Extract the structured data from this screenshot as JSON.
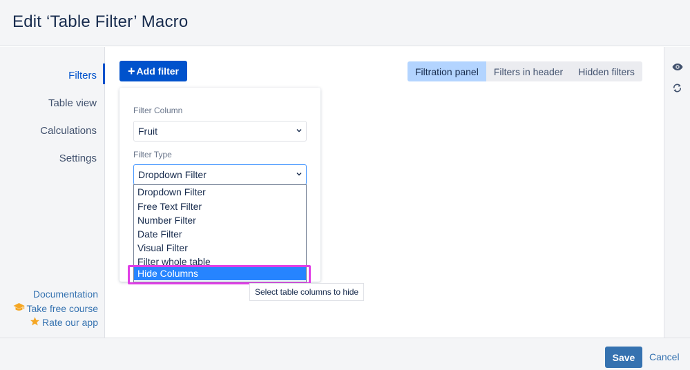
{
  "dialog": {
    "title": "Edit ‘Table Filter’ Macro"
  },
  "sidebar": {
    "items": [
      {
        "label": "Filters",
        "active": true
      },
      {
        "label": "Table view",
        "active": false
      },
      {
        "label": "Calculations",
        "active": false
      },
      {
        "label": "Settings",
        "active": false
      }
    ],
    "links": [
      {
        "label": "Documentation",
        "icon": ""
      },
      {
        "label": "Take free course",
        "icon": "graduation-cap-icon"
      },
      {
        "label": "Rate our app",
        "icon": "star-icon"
      }
    ]
  },
  "toolbar": {
    "add_filter_label": "Add filter",
    "add_icon": "plus-icon"
  },
  "tabs": [
    {
      "label": "Filtration panel",
      "active": true
    },
    {
      "label": "Filters in header",
      "active": false
    },
    {
      "label": "Hidden filters",
      "active": false
    }
  ],
  "rightbar": {
    "icons": [
      "eye-icon",
      "refresh-icon"
    ]
  },
  "filter_card": {
    "column_label": "Filter Column",
    "column_value": "Fruit",
    "type_label": "Filter Type",
    "type_value": "Dropdown Filter"
  },
  "dropdown": {
    "options": [
      "Dropdown Filter",
      "Free Text Filter",
      "Number Filter",
      "Date Filter",
      "Visual Filter",
      "Filter whole table",
      "Hide Columns"
    ],
    "highlighted": "Hide Columns"
  },
  "tooltip": {
    "text": "Select table columns to hide"
  },
  "footer": {
    "save_label": "Save",
    "cancel_label": "Cancel"
  },
  "colors": {
    "primary": "#0052cc",
    "save": "#3572b0",
    "highlight_outline": "#e03ee6",
    "selected_option": "#2684ff",
    "active_tab": "#b3d4ff"
  }
}
